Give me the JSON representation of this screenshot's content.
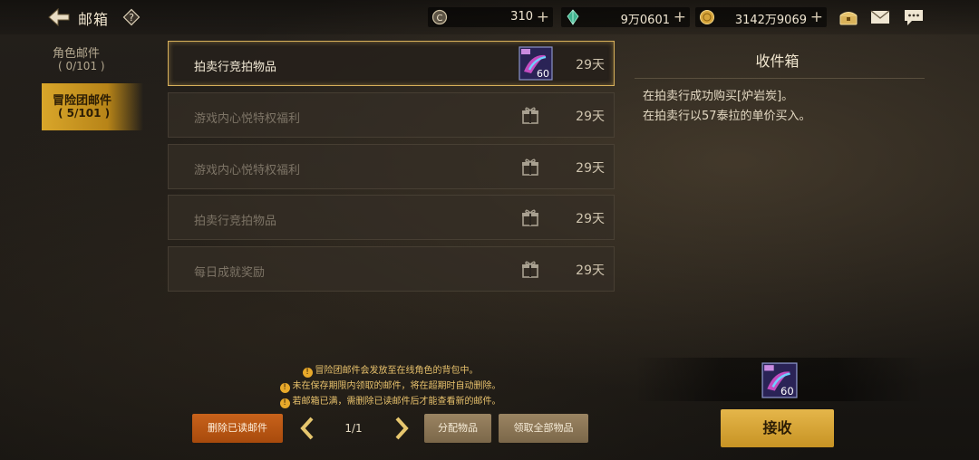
{
  "header": {
    "title": "邮箱",
    "help_symbol": "?",
    "currencies": [
      {
        "icon": "coin-c-icon",
        "value": "310",
        "plus": "+"
      },
      {
        "icon": "green-crystal-icon",
        "value": "9万0601",
        "plus": "+"
      },
      {
        "icon": "gold-coin-icon",
        "value": "3142万9069",
        "plus": "+"
      }
    ],
    "tool_icons": [
      "chest-icon",
      "mail-envelope-icon",
      "chat-bubble-icon"
    ]
  },
  "tabs": [
    {
      "name": "角色邮件",
      "count": "( 0/101 )",
      "active": false
    },
    {
      "name": "冒险团邮件",
      "count": "( 5/101 )",
      "active": true
    }
  ],
  "mails": [
    {
      "subject": "拍卖行竞拍物品",
      "days": "29天",
      "selected": true,
      "attachment": "item",
      "badge": "60"
    },
    {
      "subject": "游戏内心悦特权福利",
      "days": "29天",
      "selected": false,
      "attachment": "gift"
    },
    {
      "subject": "游戏内心悦特权福利",
      "days": "29天",
      "selected": false,
      "attachment": "gift"
    },
    {
      "subject": "拍卖行竞拍物品",
      "days": "29天",
      "selected": false,
      "attachment": "gift"
    },
    {
      "subject": "每日成就奖励",
      "days": "29天",
      "selected": false,
      "attachment": "gift"
    }
  ],
  "detail": {
    "sender": "收件箱",
    "lines": [
      "在拍卖行成功购买[炉岩炭]。",
      "在拍卖行以57泰拉的单价买入。"
    ],
    "attachment_badge": "60",
    "receive_label": "接收"
  },
  "notices": [
    "冒险团邮件会发放至在线角色的背包中。",
    "未在保存期限内领取的邮件，将在超期时自动删除。",
    "若邮箱已满，需删除已读邮件后才能查看新的邮件。"
  ],
  "bottom": {
    "delete_read_label": "删除已读邮件",
    "page": "1/1",
    "distribute_label": "分配物品",
    "claim_all_label": "领取全部物品"
  },
  "colors": {
    "accent_gold": "#d7b05a",
    "notice_text": "#e7c16c",
    "delete_orange": "#c8621b"
  }
}
